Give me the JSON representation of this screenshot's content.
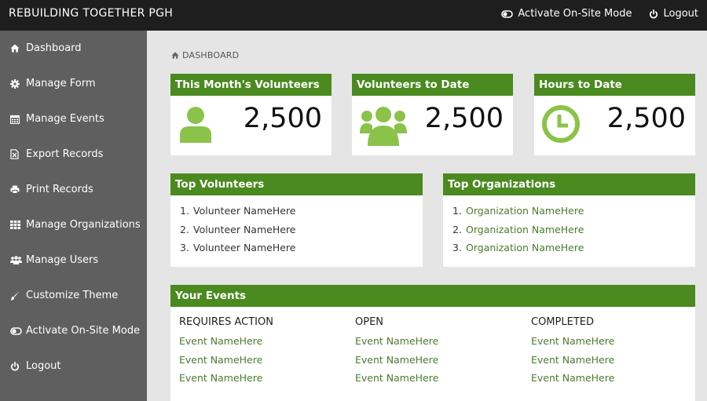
{
  "topbar": {
    "brand": "REBUILDING TOGETHER PGH",
    "actions": [
      {
        "label": "Activate On-Site Mode",
        "icon": "toggle-icon"
      },
      {
        "label": "Logout",
        "icon": "power-icon"
      }
    ]
  },
  "sidebar": {
    "items": [
      {
        "label": "Dashboard",
        "icon": "home-icon"
      },
      {
        "label": "Manage Form",
        "icon": "gear-icon"
      },
      {
        "label": "Manage Events",
        "icon": "calendar-icon"
      },
      {
        "label": "Export Records",
        "icon": "export-file-icon"
      },
      {
        "label": "Print Records",
        "icon": "printer-icon"
      },
      {
        "label": "Manage Organizations",
        "icon": "grid-icon"
      },
      {
        "label": "Manage Users",
        "icon": "users-icon"
      },
      {
        "label": "Customize Theme",
        "icon": "brush-icon"
      },
      {
        "label": "Activate On-Site Mode",
        "icon": "toggle-icon"
      },
      {
        "label": "Logout",
        "icon": "power-icon"
      }
    ]
  },
  "breadcrumb": {
    "label": "DASHBOARD",
    "icon": "home-icon"
  },
  "stats": [
    {
      "title": "This Month's Volunteers",
      "value": "2,500",
      "icon": "user-icon"
    },
    {
      "title": "Volunteers to Date",
      "value": "2,500",
      "icon": "group-icon"
    },
    {
      "title": "Hours to Date",
      "value": "2,500",
      "icon": "clock-icon"
    }
  ],
  "top_volunteers": {
    "title": "Top Volunteers",
    "items": [
      "Volunteer NameHere",
      "Volunteer NameHere",
      "Volunteer NameHere"
    ]
  },
  "top_organizations": {
    "title": "Top Organizations",
    "items": [
      "Organization NameHere",
      "Organization NameHere",
      "Organization NameHere"
    ]
  },
  "events": {
    "title": "Your Events",
    "columns": [
      {
        "heading": "REQUIRES ACTION",
        "items": [
          "Event NameHere",
          "Event NameHere",
          "Event NameHere"
        ]
      },
      {
        "heading": "OPEN",
        "items": [
          "Event NameHere",
          "Event NameHere",
          "Event NameHere"
        ]
      },
      {
        "heading": "COMPLETED",
        "items": [
          "Event NameHere",
          "Event NameHere",
          "Event NameHere"
        ]
      }
    ]
  },
  "colors": {
    "accent": "#4a8a1f",
    "icon_green": "#8bc34a",
    "link_green": "#4a7d2a",
    "topbar": "#1e1e1e",
    "sidebar": "#5f5f5f",
    "page_bg": "#e5e5e5"
  }
}
